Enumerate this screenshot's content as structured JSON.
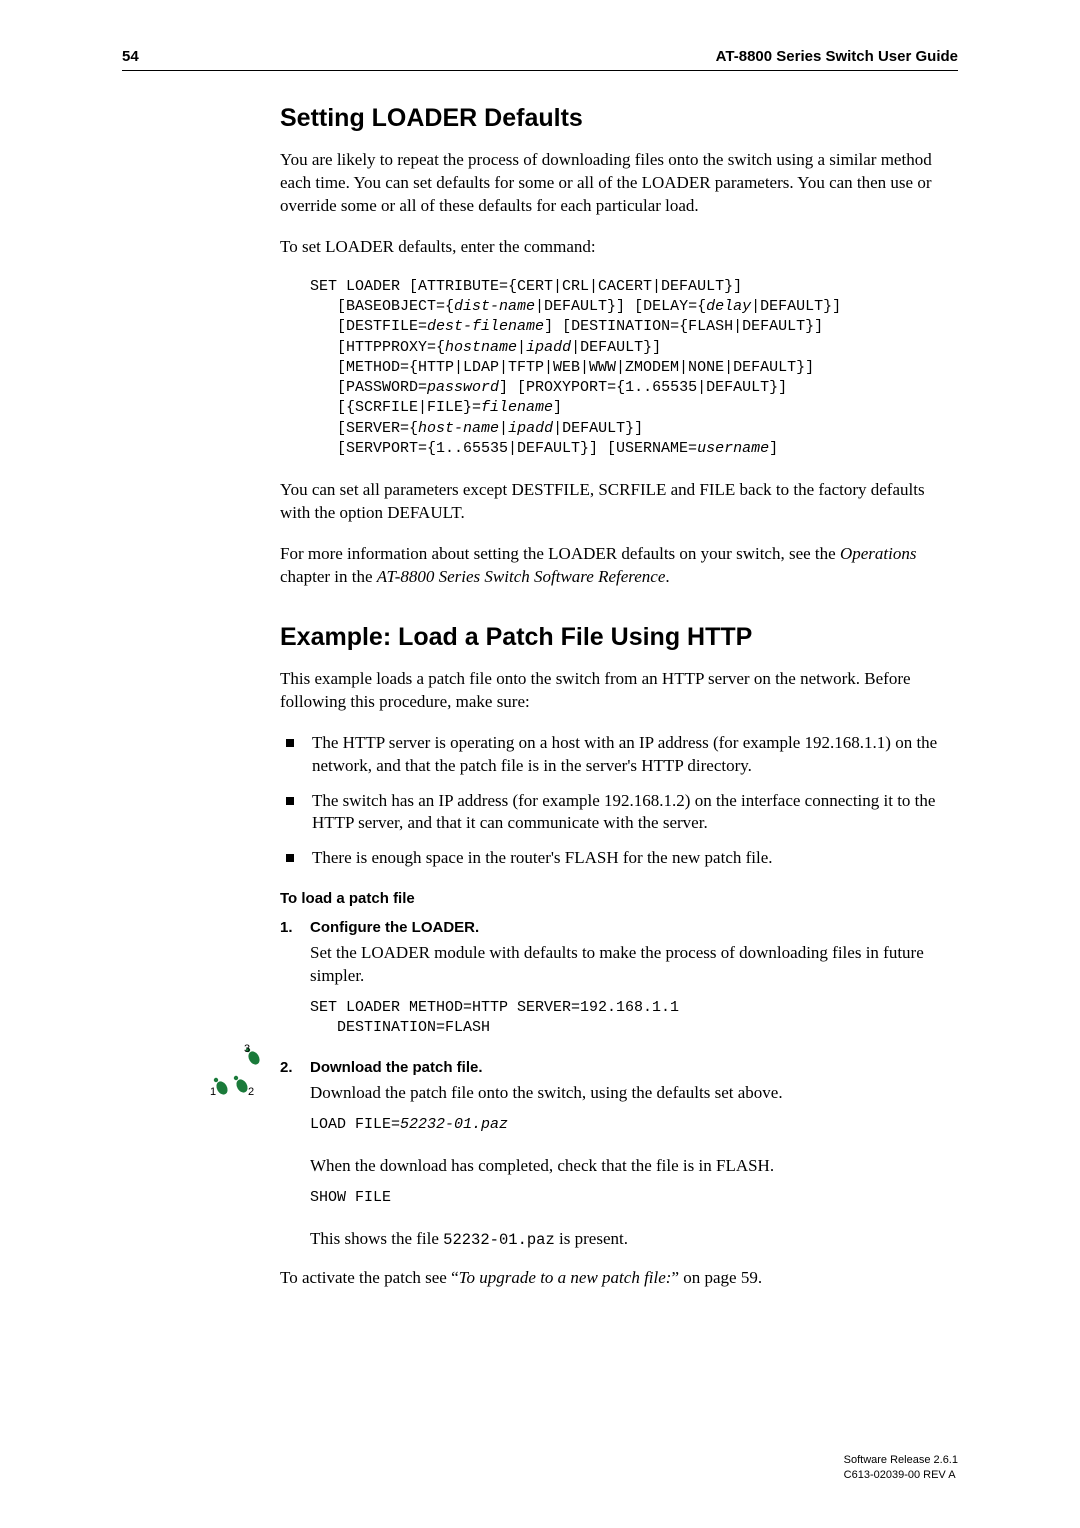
{
  "header": {
    "page_number": "54",
    "guide_title": "AT-8800 Series Switch User Guide"
  },
  "section1": {
    "title": "Setting LOADER Defaults",
    "para1": "You are likely to repeat the process of downloading files onto the switch using a similar method each time. You can set defaults for some or all of the LOADER parameters. You can then use or override some or all of these defaults for each particular load.",
    "para2": "To set LOADER defaults, enter the command:",
    "code_l1": "SET LOADER [ATTRIBUTE={CERT|CRL|CACERT|DEFAULT}]",
    "code_l2a": "   [BASEOBJECT={",
    "code_l2b": "dist-name",
    "code_l2c": "|DEFAULT}] [DELAY={",
    "code_l2d": "delay",
    "code_l2e": "|DEFAULT}]",
    "code_l3a": "   [DESTFILE=",
    "code_l3b": "dest-filename",
    "code_l3c": "] [DESTINATION={FLASH|DEFAULT}]",
    "code_l4a": "   [HTTPPROXY={",
    "code_l4b": "hostname",
    "code_l4c": "|",
    "code_l4d": "ipadd",
    "code_l4e": "|DEFAULT}]",
    "code_l5": "   [METHOD={HTTP|LDAP|TFTP|WEB|WWW|ZMODEM|NONE|DEFAULT}]",
    "code_l6a": "   [PASSWORD=",
    "code_l6b": "password",
    "code_l6c": "] [PROXYPORT={1..65535|DEFAULT}]",
    "code_l7a": "   [{SCRFILE|FILE}=",
    "code_l7b": "filename",
    "code_l7c": "]",
    "code_l8a": "   [SERVER={",
    "code_l8b": "host-name",
    "code_l8c": "|",
    "code_l8d": "ipadd",
    "code_l8e": "|DEFAULT}]",
    "code_l9a": "   [SERVPORT={1..65535|DEFAULT}] [USERNAME=",
    "code_l9b": "username",
    "code_l9c": "]",
    "para3": "You can set all parameters except DESTFILE, SCRFILE and FILE back to the factory defaults with the option DEFAULT.",
    "para4_pre": "For more information about setting the LOADER defaults on your switch, see the ",
    "para4_it1": "Operations",
    "para4_mid": " chapter in the ",
    "para4_it2": "AT-8800 Series Switch Software Reference",
    "para4_post": "."
  },
  "section2": {
    "title": "Example: Load a Patch File Using HTTP",
    "para1": "This example loads a patch file onto the switch from an HTTP server on the network. Before following this procedure, make sure:",
    "bullets": [
      "The HTTP server is operating on a host with an IP address (for example 192.168.1.1) on the network, and that the patch file is in the server's HTTP directory.",
      "The switch has an IP address (for example 192.168.1.2) on the interface connecting it to the HTTP server, and that it can communicate with the server.",
      "There is enough space in the router's FLASH for the new patch file."
    ],
    "procedure_title": "To load a patch file",
    "step1": {
      "title": "Configure the LOADER.",
      "text": "Set the LOADER module with defaults to make the process of downloading files in future simpler.",
      "code": "SET LOADER METHOD=HTTP SERVER=192.168.1.1\n   DESTINATION=FLASH"
    },
    "step2": {
      "title": "Download the patch file.",
      "text1": "Download the patch file onto the switch, using the defaults set above.",
      "code1a": "LOAD FILE=",
      "code1b": "52232-01.paz",
      "text2": "When the download has completed, check that the file is in FLASH.",
      "code2": "SHOW FILE",
      "text3_pre": "This shows the file ",
      "text3_code": "52232-01.paz",
      "text3_post": " is present."
    },
    "closing_pre": "To activate the patch see “",
    "closing_link": "To upgrade to a new patch file:",
    "closing_post": "” on page 59."
  },
  "footer": {
    "line1": "Software Release 2.6.1",
    "line2": "C613-02039-00 REV A"
  },
  "icon": {
    "label1": "1",
    "label2": "2",
    "label3": "3"
  }
}
